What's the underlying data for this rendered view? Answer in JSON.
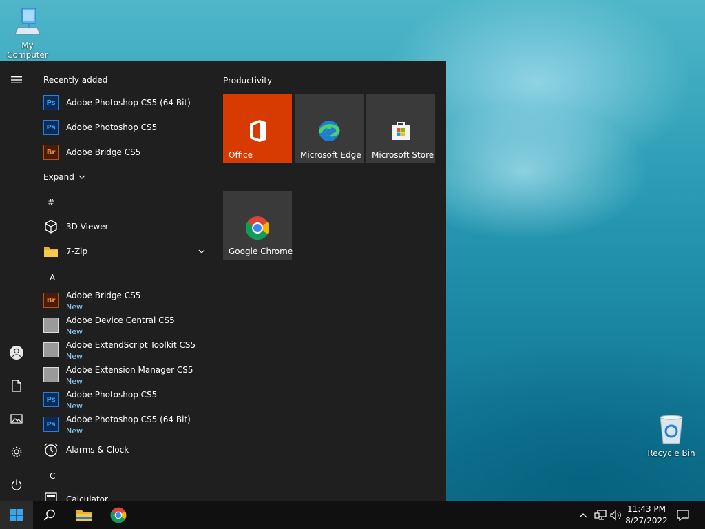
{
  "desktop": {
    "icons": [
      {
        "label": "My Computer",
        "icon": "computer-icon"
      },
      {
        "label": "Recycle Bin",
        "icon": "recycle-bin-icon"
      }
    ]
  },
  "start_menu": {
    "recently_added": {
      "title": "Recently added",
      "items": [
        {
          "label": "Adobe Photoshop CS5 (64 Bit)",
          "icon": "photoshop-icon"
        },
        {
          "label": "Adobe Photoshop CS5",
          "icon": "photoshop-icon"
        },
        {
          "label": "Adobe Bridge CS5",
          "icon": "bridge-icon"
        }
      ],
      "expand_label": "Expand"
    },
    "sections": [
      {
        "letter": "#",
        "items": [
          {
            "label": "3D Viewer",
            "icon": "cube-icon"
          },
          {
            "label": "7-Zip",
            "icon": "folder-icon",
            "expandable": true
          }
        ]
      },
      {
        "letter": "A",
        "items": [
          {
            "label": "Adobe Bridge CS5",
            "sub": "New",
            "icon": "bridge-icon"
          },
          {
            "label": "Adobe Device Central CS5",
            "sub": "New",
            "icon": "device-central-icon"
          },
          {
            "label": "Adobe ExtendScript Toolkit CS5",
            "sub": "New",
            "icon": "extendscript-icon"
          },
          {
            "label": "Adobe Extension Manager CS5",
            "sub": "New",
            "icon": "extension-manager-icon"
          },
          {
            "label": "Adobe Photoshop CS5",
            "sub": "New",
            "icon": "photoshop-icon"
          },
          {
            "label": "Adobe Photoshop CS5 (64 Bit)",
            "sub": "New",
            "icon": "photoshop-icon"
          },
          {
            "label": "Alarms & Clock",
            "icon": "alarm-clock-icon"
          }
        ]
      },
      {
        "letter": "C",
        "items": [
          {
            "label": "Calculator",
            "icon": "calculator-icon"
          }
        ]
      }
    ],
    "tiles_group": {
      "title": "Productivity",
      "tiles": [
        {
          "label": "Office",
          "icon": "office-icon",
          "bg": "#d83b01"
        },
        {
          "label": "Microsoft Edge",
          "icon": "edge-icon",
          "bg": "#3a3a3a"
        },
        {
          "label": "Microsoft Store",
          "icon": "store-icon",
          "bg": "#3a3a3a"
        },
        {
          "label": "Google Chrome",
          "icon": "chrome-icon",
          "bg": "#3a3a3a"
        }
      ]
    },
    "rail": [
      "hamburger-menu-icon",
      "user-icon",
      "documents-icon",
      "pictures-icon",
      "settings-icon",
      "power-icon"
    ]
  },
  "taskbar": {
    "pinned": [
      "windows-start-icon",
      "search-icon",
      "file-explorer-icon",
      "chrome-icon"
    ],
    "tray": [
      "chevron-up-icon",
      "network-icon",
      "volume-icon"
    ],
    "time": "11:43 PM",
    "date": "8/27/2022",
    "notification_icon": "notification-icon"
  },
  "colors": {
    "accent": "#d83b01",
    "start_bg": "#1f1f1f",
    "tile_bg": "#3a3a3a",
    "taskbar_bg": "#101010",
    "new_badge": "#8fd3ff"
  }
}
